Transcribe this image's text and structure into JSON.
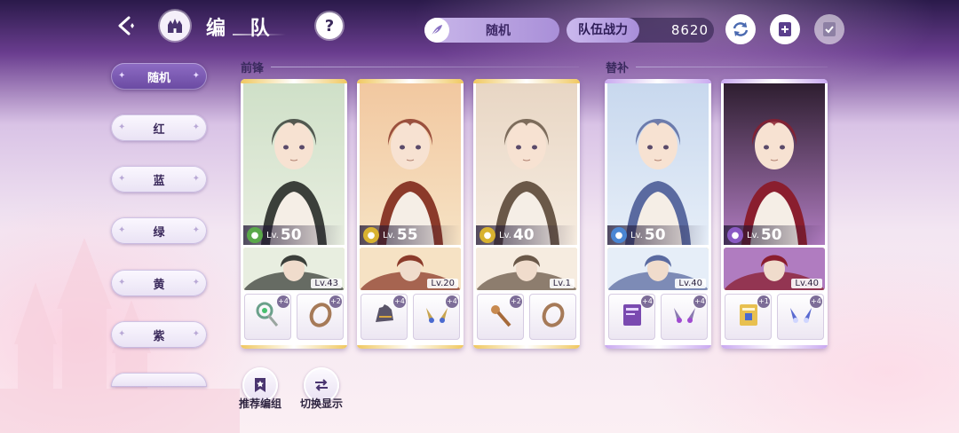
{
  "header": {
    "title": "编 队",
    "mode_label": "随机",
    "power_label": "队伍战力",
    "power_value": "8620"
  },
  "icons": {
    "back": "back-arrow-icon",
    "home": "castle-home-icon",
    "help": "question-icon",
    "mode": "feather-icon",
    "refresh": "refresh-icon",
    "add": "add-document-icon",
    "check": "checklist-icon"
  },
  "sidebar": {
    "items": [
      {
        "label": "随机",
        "active": true
      },
      {
        "label": "红",
        "active": false
      },
      {
        "label": "蓝",
        "active": false
      },
      {
        "label": "绿",
        "active": false
      },
      {
        "label": "黄",
        "active": false
      },
      {
        "label": "紫",
        "active": false
      },
      {
        "label": "",
        "active": false
      }
    ]
  },
  "sections": {
    "front": "前锋",
    "sub": "替补"
  },
  "cards": [
    {
      "element": "green",
      "element_color": "#5aa84a",
      "lv_prefix": "Lv.",
      "level": "50",
      "sub_level": "Lv.43",
      "rarity_color": "#f0c860",
      "equip": [
        {
          "icon": "green-orb-wand-icon",
          "plus": "+4"
        },
        {
          "icon": "bronze-ring-icon",
          "plus": "+2"
        }
      ],
      "palette": [
        "#cfe0c8",
        "#e8eee0",
        "#3b3f3a"
      ]
    },
    {
      "element": "yellow",
      "element_color": "#d8b230",
      "lv_prefix": "Lv.",
      "level": "55",
      "sub_level": "Lv.20",
      "rarity_color": "#f0c860",
      "equip": [
        {
          "icon": "gauntlet-icon",
          "plus": "+4"
        },
        {
          "icon": "gold-earrings-icon",
          "plus": "+4"
        }
      ],
      "palette": [
        "#f2c8a0",
        "#f6e2c4",
        "#8b3a2a"
      ]
    },
    {
      "element": "yellow",
      "element_color": "#d8b230",
      "lv_prefix": "Lv.",
      "level": "40",
      "sub_level": "Lv.1",
      "rarity_color": "#f0c860",
      "equip": [
        {
          "icon": "bronze-scepter-icon",
          "plus": "+2"
        },
        {
          "icon": "bronze-ring-icon",
          "plus": ""
        }
      ],
      "palette": [
        "#e8d6c4",
        "#f6ece0",
        "#6a5848"
      ]
    },
    {
      "element": "blue",
      "element_color": "#4a86d4",
      "lv_prefix": "Lv.",
      "level": "50",
      "sub_level": "Lv.40",
      "rarity_color": "#c9a8f0",
      "equip": [
        {
          "icon": "purple-tome-icon",
          "plus": "+4"
        },
        {
          "icon": "purple-earrings-icon",
          "plus": "+4"
        }
      ],
      "palette": [
        "#c8d8ee",
        "#e6eef8",
        "#5a6aa0"
      ]
    },
    {
      "element": "purple",
      "element_color": "#8a5ac4",
      "lv_prefix": "Lv.",
      "level": "50",
      "sub_level": "Lv.40",
      "rarity_color": "#c9a8f0",
      "equip": [
        {
          "icon": "gold-tome-icon",
          "plus": "+1"
        },
        {
          "icon": "blue-earrings-icon",
          "plus": "+4"
        }
      ],
      "palette": [
        "#2e1e30",
        "#b07cc0",
        "#8a1e2e"
      ]
    }
  ],
  "bottom": {
    "recommend_label": "推荐编组",
    "switch_label": "切换显示"
  }
}
